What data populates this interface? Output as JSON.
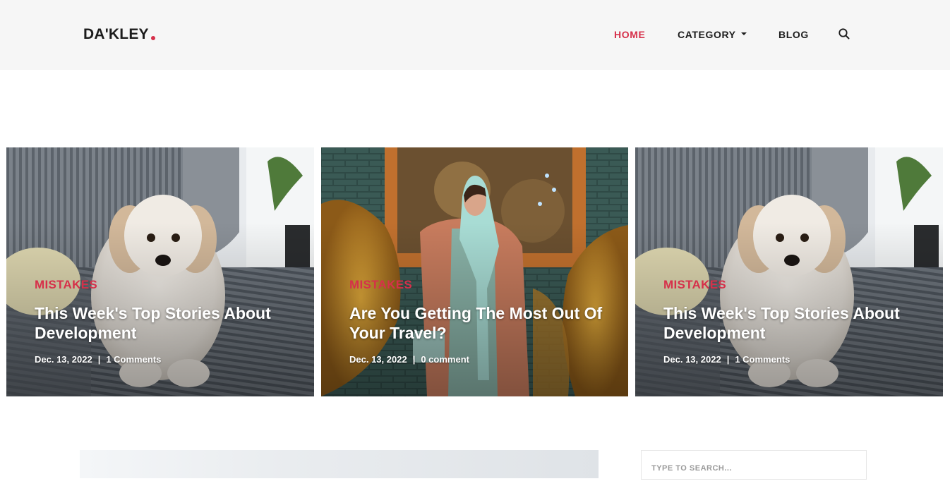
{
  "brand": {
    "name": "DA'KLEY"
  },
  "nav": {
    "home": "HOME",
    "category": "CATEGORY",
    "blog": "BLOG"
  },
  "posts": [
    {
      "category": "MISTAKES",
      "title": "This Week's Top Stories About Development",
      "date": "Dec. 13, 2022",
      "comments": "1 Comments"
    },
    {
      "category": "MISTAKES",
      "title": "Are You Getting The Most Out Of Your Travel?",
      "date": "Dec. 13, 2022",
      "comments": "0 comment"
    },
    {
      "category": "MISTAKES",
      "title": "This Week's Top Stories About Development",
      "date": "Dec. 13, 2022",
      "comments": "1 Comments"
    }
  ],
  "sidebar": {
    "search_placeholder": "TYPE TO SEARCH..."
  },
  "colors": {
    "accent": "#d6304a",
    "header_bg": "#f6f6f6",
    "text": "#1c1c1c"
  },
  "icons": {
    "search": "search-icon",
    "dropdown": "chevron-down-icon"
  }
}
